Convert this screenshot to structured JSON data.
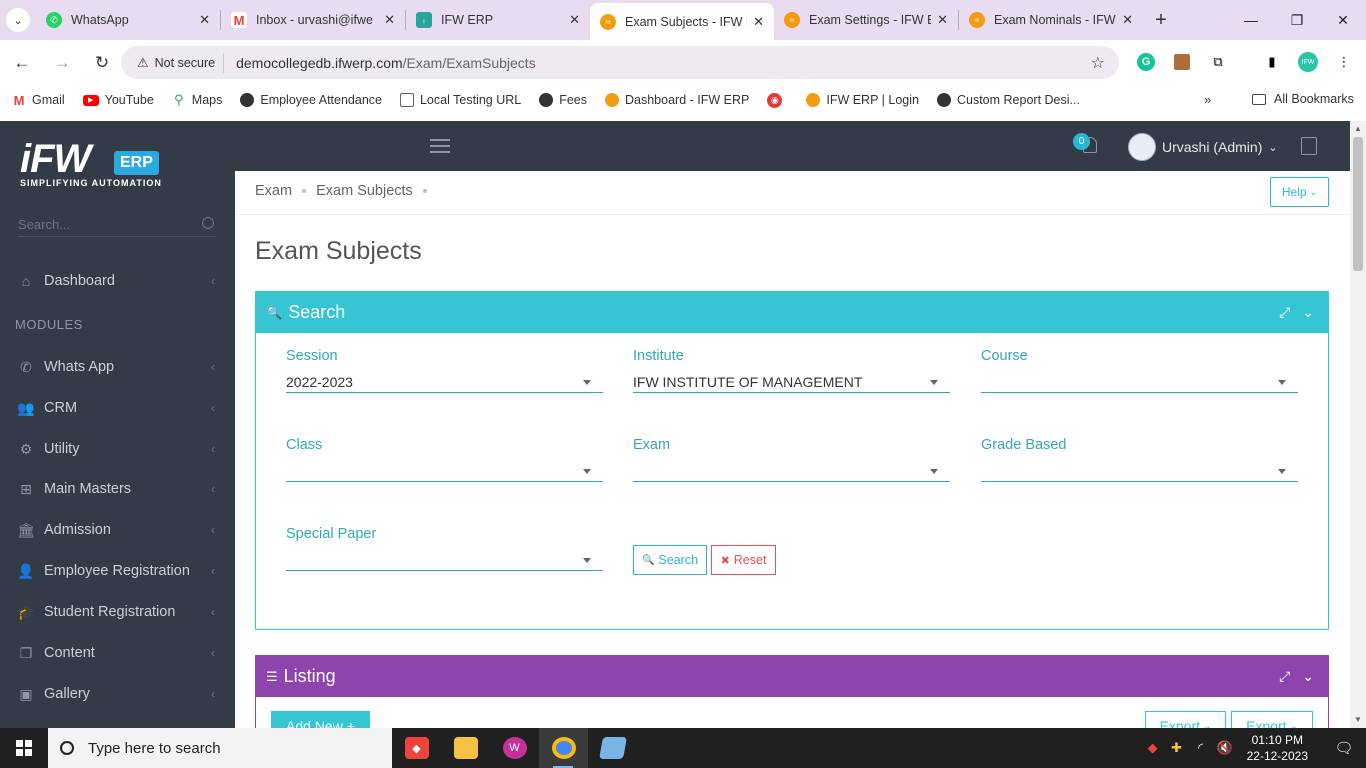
{
  "browser": {
    "tabs": [
      {
        "label": "WhatsApp",
        "favicon": "whatsapp-icon",
        "color": "#25d366",
        "active": false
      },
      {
        "label": "Inbox - urvashi@ifwe",
        "favicon": "gmail-icon",
        "color": "#ea4335",
        "active": false
      },
      {
        "label": "IFW ERP",
        "favicon": "ifw-icon",
        "color": "#26a69a",
        "active": false
      },
      {
        "label": "Exam Subjects - IFW E",
        "favicon": "ifw-erp-icon",
        "color": "#f39c12",
        "active": true
      },
      {
        "label": "Exam Settings - IFW E",
        "favicon": "ifw-erp-icon",
        "color": "#f39c12",
        "active": false
      },
      {
        "label": "Exam Nominals - IFW",
        "favicon": "ifw-erp-icon",
        "color": "#f39c12",
        "active": false
      }
    ],
    "security_label": "Not secure",
    "url_host": "democollegedb.ifwerp.com",
    "url_path": "/Exam/ExamSubjects",
    "bookmarks": [
      {
        "label": "Gmail",
        "icon": "gmail-icon",
        "color": "#ea4335"
      },
      {
        "label": "YouTube",
        "icon": "youtube-icon",
        "color": "#ff0000"
      },
      {
        "label": "Maps",
        "icon": "maps-icon",
        "color": "#34a853"
      },
      {
        "label": "Employee Attendance",
        "icon": "globe-icon",
        "color": "#333333"
      },
      {
        "label": "Local Testing URL",
        "icon": "page-icon",
        "color": "#5f6368"
      },
      {
        "label": "Fees",
        "icon": "globe-icon",
        "color": "#333333"
      },
      {
        "label": "Dashboard - IFW ERP",
        "icon": "ifw-erp-icon",
        "color": "#f39c12"
      },
      {
        "label": "",
        "icon": "target-icon",
        "color": "#e53935"
      },
      {
        "label": "IFW ERP | Login",
        "icon": "ifw-erp-icon",
        "color": "#f39c12"
      },
      {
        "label": "Custom Report Desi...",
        "icon": "globe-icon",
        "color": "#333333"
      }
    ],
    "more_bookmarks": "»",
    "all_bookmarks": "All Bookmarks"
  },
  "app": {
    "logo_text": "iFW",
    "logo_badge": "ERP",
    "logo_tagline": "SIMPLIFYING AUTOMATION",
    "sidebar_search_placeholder": "Search...",
    "modules_label": "MODULES",
    "menu": [
      {
        "label": "Dashboard",
        "icon": "home-icon"
      },
      {
        "label": "Whats App",
        "icon": "whatsapp-icon"
      },
      {
        "label": "CRM",
        "icon": "users-icon"
      },
      {
        "label": "Utility",
        "icon": "gears-icon"
      },
      {
        "label": "Main Masters",
        "icon": "sitemap-icon"
      },
      {
        "label": "Admission",
        "icon": "institution-icon"
      },
      {
        "label": "Employee Registration",
        "icon": "user-icon"
      },
      {
        "label": "Student Registration",
        "icon": "graduation-cap-icon"
      },
      {
        "label": "Content",
        "icon": "copy-icon"
      },
      {
        "label": "Gallery",
        "icon": "image-icon"
      }
    ],
    "notification_count": "0",
    "user_name": "Urvashi (Admin)",
    "breadcrumb": [
      "Exam",
      "Exam Subjects"
    ],
    "help_label": "Help",
    "page_title": "Exam Subjects",
    "search_panel": {
      "title": "Search",
      "color": "#36c6d3",
      "fields": [
        {
          "label": "Session",
          "value": "2022-2023"
        },
        {
          "label": "Institute",
          "value": "IFW INSTITUTE OF MANAGEMENT"
        },
        {
          "label": "Course",
          "value": ""
        },
        {
          "label": "Class",
          "value": ""
        },
        {
          "label": "Exam",
          "value": ""
        },
        {
          "label": "Grade Based",
          "value": ""
        },
        {
          "label": "Special Paper",
          "value": ""
        }
      ],
      "search_button": "Search",
      "reset_button": "Reset"
    },
    "listing_panel": {
      "title": "Listing",
      "color": "#8e44ad",
      "add_new_button": "Add New",
      "export_buttons": [
        "Export",
        "Export"
      ]
    }
  },
  "taskbar": {
    "search_placeholder": "Type here to search",
    "time": "01:10 PM",
    "date": "22-12-2023"
  }
}
